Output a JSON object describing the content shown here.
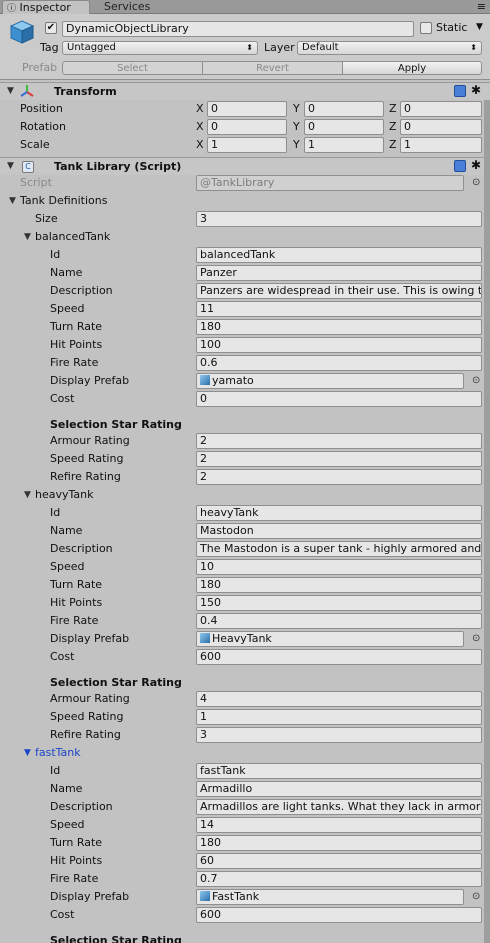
{
  "tabs": {
    "inspector": "Inspector",
    "services": "Services"
  },
  "object": {
    "name": "DynamicObjectLibrary",
    "static_label": "Static",
    "tag_label": "Tag",
    "tag_value": "Untagged",
    "layer_label": "Layer",
    "layer_value": "Default",
    "prefab_label": "Prefab",
    "select": "Select",
    "revert": "Revert",
    "apply": "Apply"
  },
  "transform": {
    "title": "Transform",
    "rows": [
      {
        "label": "Position",
        "x": "0",
        "y": "0",
        "z": "0"
      },
      {
        "label": "Rotation",
        "x": "0",
        "y": "0",
        "z": "0"
      },
      {
        "label": "Scale",
        "x": "1",
        "y": "1",
        "z": "1"
      }
    ],
    "axis": {
      "x": "X",
      "y": "Y",
      "z": "Z"
    }
  },
  "script": {
    "title": "Tank Library (Script)",
    "script_label": "Script",
    "script_value": "TankLibrary",
    "definitions_label": "Tank Definitions",
    "size_label": "Size",
    "size_value": "3"
  },
  "field_labels": {
    "id": "Id",
    "name": "Name",
    "description": "Description",
    "speed": "Speed",
    "turn_rate": "Turn Rate",
    "hit_points": "Hit Points",
    "fire_rate": "Fire Rate",
    "display_prefab": "Display Prefab",
    "cost": "Cost",
    "selection_header": "Selection Star Rating",
    "armour_rating": "Armour Rating",
    "speed_rating": "Speed Rating",
    "refire_rating": "Refire Rating"
  },
  "tanks": [
    {
      "foldout": "balancedTank",
      "id": "balancedTank",
      "name": "Panzer",
      "description": "Panzers are widespread in their use. This is owing to",
      "speed": "11",
      "turn_rate": "180",
      "hit_points": "100",
      "fire_rate": "0.6",
      "display_prefab": "yamato",
      "cost": "0",
      "armour_rating": "2",
      "speed_rating": "2",
      "refire_rating": "2"
    },
    {
      "foldout": "heavyTank",
      "id": "heavyTank",
      "name": "Mastodon",
      "description": "The Mastodon is a super tank - highly armored and la",
      "speed": "10",
      "turn_rate": "180",
      "hit_points": "150",
      "fire_rate": "0.4",
      "display_prefab": "HeavyTank",
      "cost": "600",
      "armour_rating": "4",
      "speed_rating": "1",
      "refire_rating": "3"
    },
    {
      "foldout": "fastTank",
      "id": "fastTank",
      "name": "Armadillo",
      "description": "Armadillos are light tanks. What they lack in armor th",
      "speed": "14",
      "turn_rate": "180",
      "hit_points": "60",
      "fire_rate": "0.7",
      "display_prefab": "FastTank",
      "cost": "600",
      "armour_rating": "",
      "speed_rating": "",
      "refire_rating": ""
    }
  ],
  "icons": {
    "cube": "cube-icon",
    "transform": "transform-icon",
    "script": "script-icon",
    "help": "help-icon",
    "gear": "gear-icon"
  },
  "colors": {
    "active_foldout": "#1b46c8",
    "panel": "#c2c2c2"
  }
}
